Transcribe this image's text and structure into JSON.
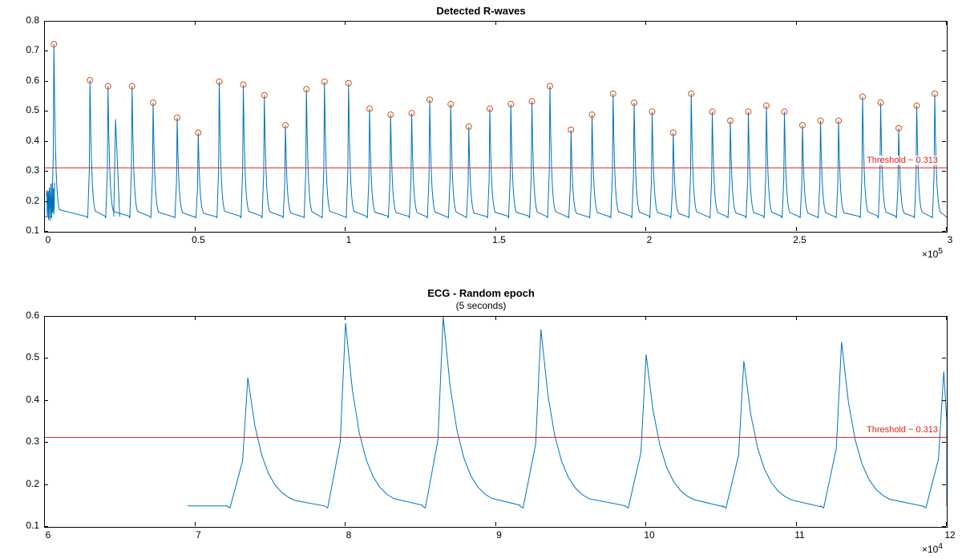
{
  "chart_data": [
    {
      "type": "line",
      "title": "Detected R-waves",
      "xlim": [
        0,
        300000
      ],
      "ylim": [
        0.1,
        0.8
      ],
      "xticks": [
        0,
        50000,
        100000,
        150000,
        200000,
        250000,
        300000
      ],
      "xticklabels": [
        "0",
        "0.5",
        "1",
        "1.5",
        "2",
        "2.5",
        "3"
      ],
      "yticks": [
        0.1,
        0.2,
        0.3,
        0.4,
        0.5,
        0.6,
        0.7,
        0.8
      ],
      "x_exponent_label": "×10^5",
      "threshold": 0.313,
      "threshold_label": "Threshold ~ 0.313",
      "peaks_x": [
        3000,
        15000,
        21000,
        29000,
        36000,
        44000,
        51000,
        58000,
        66000,
        73000,
        80000,
        87000,
        93000,
        101000,
        108000,
        115000,
        122000,
        128000,
        135000,
        141000,
        148000,
        155000,
        162000,
        168000,
        175000,
        182000,
        189000,
        196000,
        202000,
        209000,
        215000,
        222000,
        228000,
        234000,
        240000,
        246000,
        252000,
        258000,
        264000,
        272000,
        278000,
        284000,
        290000,
        296000
      ],
      "peaks_y": [
        0.725,
        0.605,
        0.585,
        0.585,
        0.53,
        0.48,
        0.43,
        0.6,
        0.59,
        0.555,
        0.455,
        0.575,
        0.6,
        0.595,
        0.51,
        0.49,
        0.495,
        0.54,
        0.525,
        0.45,
        0.51,
        0.525,
        0.535,
        0.585,
        0.44,
        0.49,
        0.56,
        0.53,
        0.5,
        0.43,
        0.56,
        0.5,
        0.47,
        0.5,
        0.52,
        0.5,
        0.455,
        0.47,
        0.47,
        0.55,
        0.53,
        0.445,
        0.52,
        0.56
      ],
      "baseline": 0.15
    },
    {
      "type": "line",
      "title": "ECG - Random epoch",
      "subtitle": "(5 seconds)",
      "xlim": [
        60000,
        120000
      ],
      "ylim": [
        0.1,
        0.6
      ],
      "xticks": [
        60000,
        70000,
        80000,
        90000,
        100000,
        110000,
        120000
      ],
      "xticklabels": [
        "6",
        "7",
        "8",
        "9",
        "10",
        "11",
        "12"
      ],
      "yticks": [
        0.1,
        0.2,
        0.3,
        0.4,
        0.5,
        0.6
      ],
      "x_exponent_label": "×10^4",
      "threshold": 0.313,
      "threshold_label": "Threshold ~ 0.313",
      "peaks_x": [
        73500,
        80000,
        86500,
        93000,
        100000,
        106500,
        113000,
        119800
      ],
      "peaks_y": [
        0.455,
        0.585,
        0.6,
        0.57,
        0.51,
        0.495,
        0.54,
        0.47
      ],
      "baseline": 0.15,
      "data_start_x": 69500
    }
  ]
}
